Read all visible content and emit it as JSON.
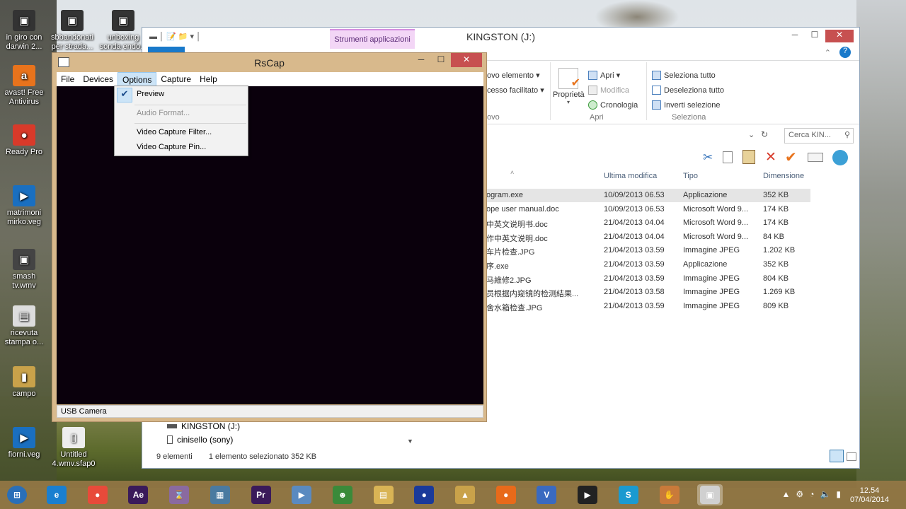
{
  "desktop": {
    "icons": [
      {
        "label": "in giro con\ndarwin 2...",
        "glyph": "▣"
      },
      {
        "label": "sbbandonati\nper strada...",
        "glyph": "▣"
      },
      {
        "label": "unboxing\nsonda endo...",
        "glyph": "▣"
      },
      {
        "label": "avast! Free\nAntivirus",
        "glyph": "a"
      },
      {
        "label": "Ready Pro",
        "glyph": "●"
      },
      {
        "label": "matrimoni\nmirko.veg",
        "glyph": "▶"
      },
      {
        "label": "smash\ntv.wmv",
        "glyph": "▣"
      },
      {
        "label": "ricevuta\nstampa o...",
        "glyph": "▤"
      },
      {
        "label": "campo",
        "glyph": "▮"
      },
      {
        "label": "fiorni.veg",
        "glyph": "▶"
      },
      {
        "label": "Untitled\n4.wmv.sfap0",
        "glyph": "▯"
      }
    ]
  },
  "explorer": {
    "title": "KINGSTON (J:)",
    "context_tab": "Strumenti applicazioni",
    "ribbon": {
      "new_item": "ovo elemento ▾",
      "easy_access": "cesso facilitato ▾",
      "new_group": "ovo",
      "properties": "Proprietà",
      "open": "Apri ▾",
      "edit": "Modifica",
      "history": "Cronologia",
      "open_group": "Apri",
      "select_all": "Seleziona tutto",
      "deselect_all": "Deseleziona tutto",
      "invert_selection": "Inverti selezione",
      "select_group": "Seleziona"
    },
    "search_placeholder": "Cerca KIN...",
    "columns": {
      "modified": "Ultima modifica",
      "type": "Tipo",
      "size": "Dimensione"
    },
    "files": [
      {
        "name": "ogram.exe",
        "modified": "10/09/2013 06.53",
        "type": "Applicazione",
        "size": "352 KB"
      },
      {
        "name": "ope user manual.doc",
        "modified": "10/09/2013 06.53",
        "type": "Microsoft Word 9...",
        "size": "174 KB"
      },
      {
        "name": "中英文说明书.doc",
        "modified": "21/04/2013 04.04",
        "type": "Microsoft Word 9...",
        "size": "174 KB"
      },
      {
        "name": "作中英文说明.doc",
        "modified": "21/04/2013 04.04",
        "type": "Microsoft Word 9...",
        "size": "84 KB"
      },
      {
        "name": "车片检查.JPG",
        "modified": "21/04/2013 03.59",
        "type": "Immagine JPEG",
        "size": "1.202 KB"
      },
      {
        "name": "序.exe",
        "modified": "21/04/2013 03.59",
        "type": "Applicazione",
        "size": "352 KB"
      },
      {
        "name": "马維修2.JPG",
        "modified": "21/04/2013 03.59",
        "type": "Immagine JPEG",
        "size": "804 KB"
      },
      {
        "name": "员根据内窥镜的检测結果...",
        "modified": "21/04/2013 03.58",
        "type": "Immagine JPEG",
        "size": "1.269 KB"
      },
      {
        "name": "舍水箱检查.JPG",
        "modified": "21/04/2013 03.59",
        "type": "Immagine JPEG",
        "size": "809 KB"
      }
    ],
    "nav": {
      "drive": "KINGSTON (J:)",
      "other": "cinisello (sony)"
    },
    "status": {
      "count": "9 elementi",
      "selected": "1 elemento selezionato  352 KB"
    }
  },
  "rscap": {
    "title": "RsCap",
    "menu": [
      "File",
      "Devices",
      "Options",
      "Capture",
      "Help"
    ],
    "options_menu": {
      "preview": "Preview",
      "audio_format": "Audio Format...",
      "video_filter": "Video Capture Filter...",
      "video_pin": "Video Capture Pin..."
    },
    "status": "USB Camera"
  },
  "taskbar": {
    "apps": [
      "start-orb",
      "ie",
      "chrome",
      "ae",
      "hourglass",
      "video",
      "pr",
      "player",
      "frog",
      "folder",
      "globe",
      "tool",
      "firefox",
      "vegas",
      "media",
      "skype",
      "glove",
      "rscap"
    ],
    "time": "12.54",
    "date": "07/04/2014"
  }
}
